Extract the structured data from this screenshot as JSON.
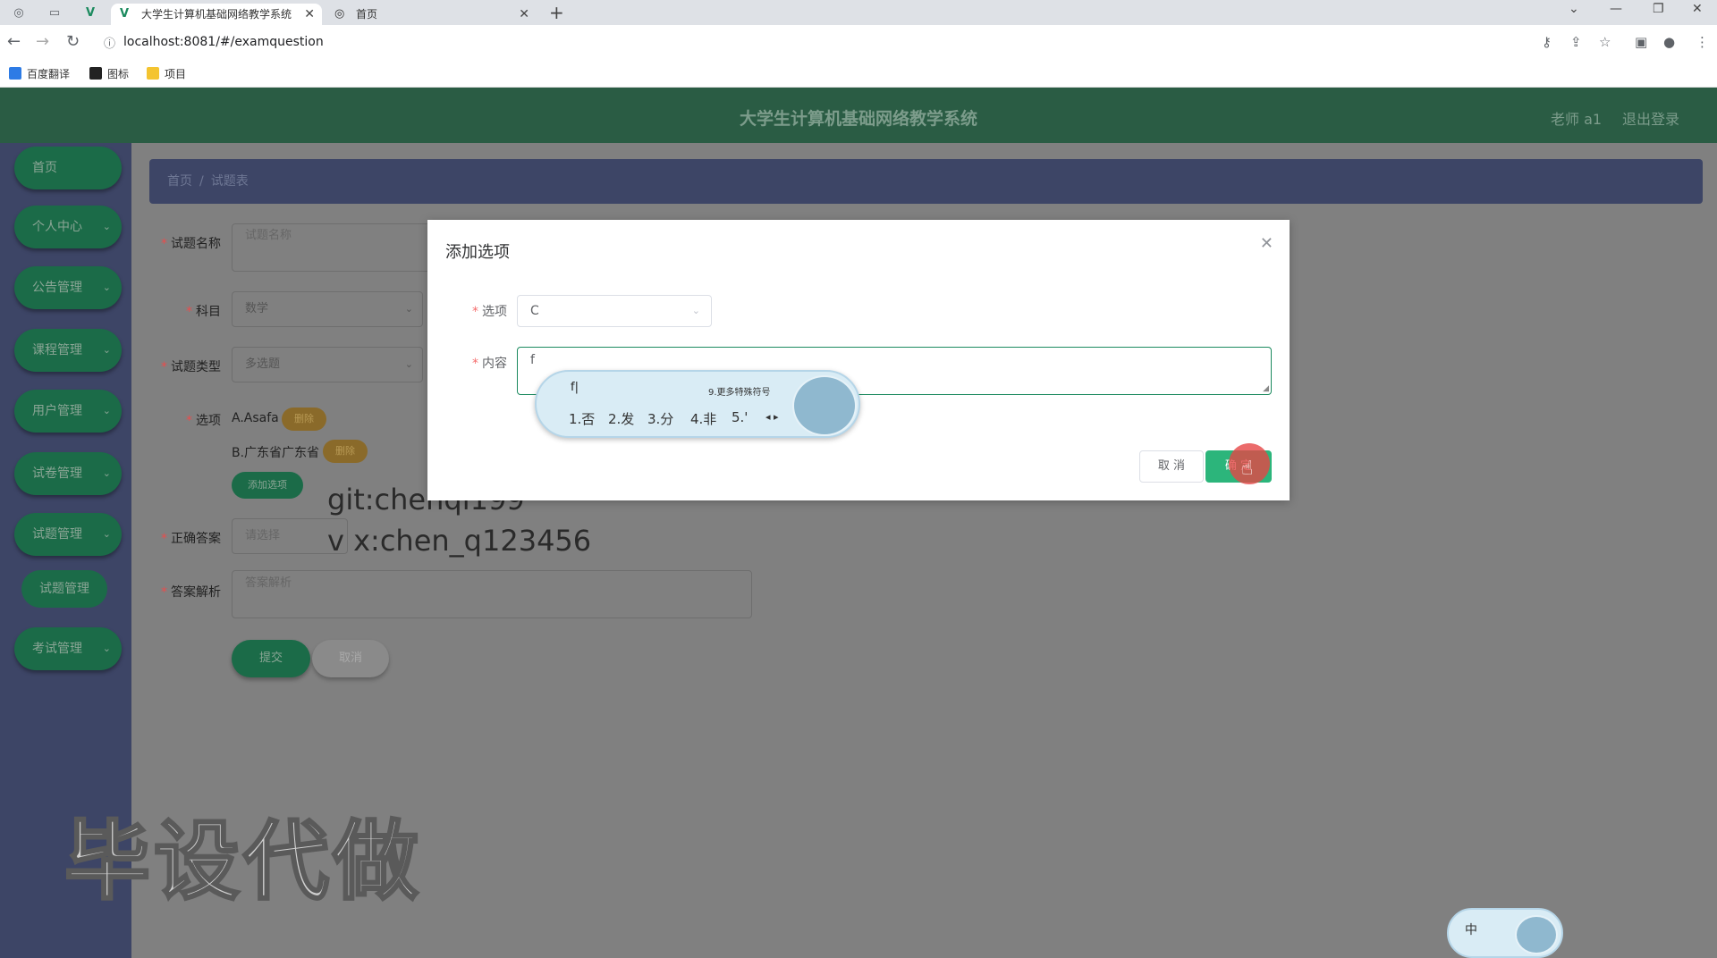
{
  "browser": {
    "tabs": [
      {
        "title": "大学生计算机基础网络教学系统",
        "active": true
      },
      {
        "title": "首页",
        "active": false
      }
    ],
    "url": "localhost:8081/#/examquestion",
    "bookmarks": [
      "百度翻译",
      "图标",
      "项目"
    ]
  },
  "header": {
    "title": "大学生计算机基础网络教学系统",
    "user": "老师 a1",
    "logout": "退出登录"
  },
  "sidebar": {
    "items": [
      {
        "label": "首页",
        "expandable": false
      },
      {
        "label": "个人中心",
        "expandable": true
      },
      {
        "label": "公告管理",
        "expandable": true
      },
      {
        "label": "课程管理",
        "expandable": true
      },
      {
        "label": "用户管理",
        "expandable": true
      },
      {
        "label": "试卷管理",
        "expandable": true
      },
      {
        "label": "试题管理",
        "expandable": true
      },
      {
        "label": "考试管理",
        "expandable": true
      }
    ],
    "submenu": {
      "label": "试题管理"
    }
  },
  "breadcrumb": {
    "home": "首页",
    "separator": "/",
    "current": "试题表"
  },
  "form": {
    "name_label": "试题名称",
    "name_placeholder": "试题名称",
    "subject_label": "科目",
    "subject_value": "数学",
    "type_label": "试题类型",
    "type_value": "多选题",
    "options_label": "选项",
    "options": [
      {
        "text": "A.Asafa",
        "delete": "删除"
      },
      {
        "text": "B.广东省广东省",
        "delete": "删除"
      }
    ],
    "add_option": "添加选项",
    "answer_label": "正确答案",
    "answer_placeholder": "请选择",
    "analysis_label": "答案解析",
    "analysis_placeholder": "答案解析",
    "submit": "提交",
    "cancel": "取消"
  },
  "watermark": {
    "git": "git:chenqi199",
    "wx": "v x:chen_q123456",
    "big": "毕设代做"
  },
  "dialog": {
    "title": "添加选项",
    "option_label": "选项",
    "option_value": "C",
    "content_label": "内容",
    "content_value": "f",
    "cancel": "取 消",
    "confirm": "确 定"
  },
  "ime": {
    "input": "f|",
    "hint": "9.更多特殊符号",
    "candidates": [
      "1.否",
      "2.发",
      "3.分",
      "4.非",
      "5.'"
    ],
    "mode": "中"
  },
  "colors": {
    "header_bg": "#2a5c44",
    "sidebar_bg": "#3d4566",
    "accent_green": "#2cb57b",
    "delete_badge": "#8a6a2a"
  }
}
